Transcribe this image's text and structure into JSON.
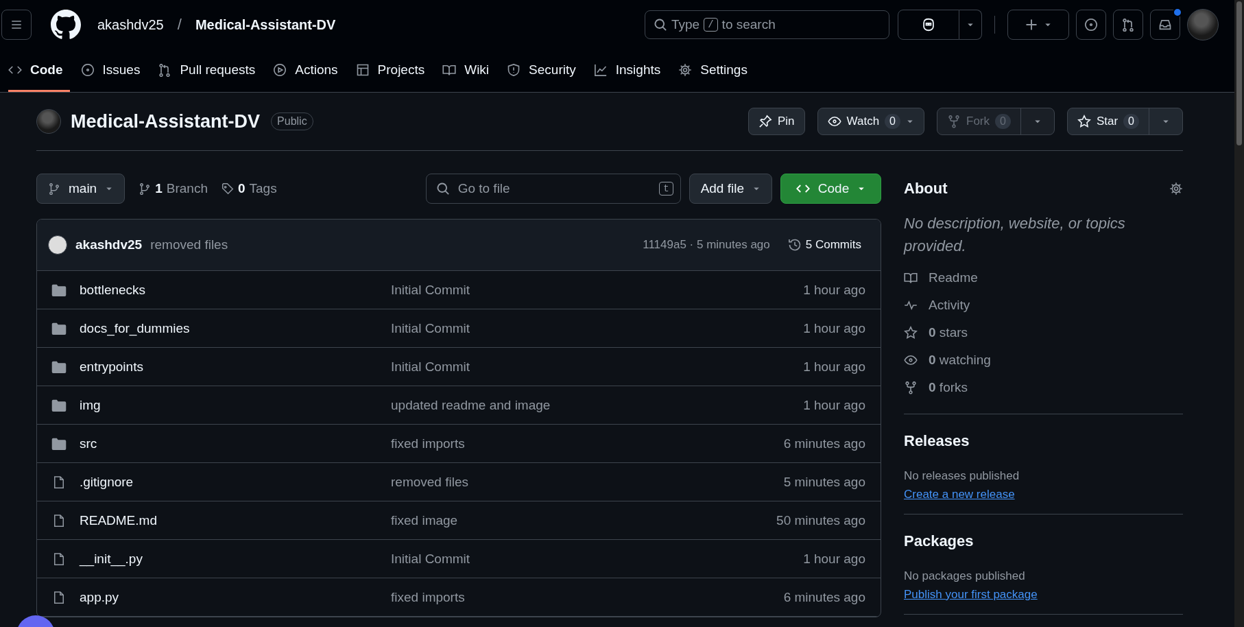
{
  "header": {
    "owner": "akashdv25",
    "separator": "/",
    "repo": "Medical-Assistant-DV",
    "search": {
      "placeholder_before": "Type",
      "key": "/",
      "placeholder_after": "to search"
    },
    "inbox_unread": true
  },
  "nav_tabs": [
    {
      "kind": "code",
      "label": "Code",
      "selected": true
    },
    {
      "kind": "issues",
      "label": "Issues",
      "selected": false
    },
    {
      "kind": "pulls",
      "label": "Pull requests",
      "selected": false
    },
    {
      "kind": "actions",
      "label": "Actions",
      "selected": false
    },
    {
      "kind": "projects",
      "label": "Projects",
      "selected": false
    },
    {
      "kind": "wiki",
      "label": "Wiki",
      "selected": false
    },
    {
      "kind": "security",
      "label": "Security",
      "selected": false
    },
    {
      "kind": "insights",
      "label": "Insights",
      "selected": false
    },
    {
      "kind": "settings",
      "label": "Settings",
      "selected": false
    }
  ],
  "repo": {
    "name": "Medical-Assistant-DV",
    "visibility": "Public",
    "actions": [
      {
        "kind": "pin",
        "label": "Pin",
        "disabled": false
      },
      {
        "kind": "watch",
        "label": "Watch",
        "count": "0",
        "disabled": false
      },
      {
        "kind": "fork",
        "label": "Fork",
        "count": "0",
        "disabled": true
      },
      {
        "kind": "star",
        "label": "Star",
        "count": "0",
        "disabled": false
      }
    ]
  },
  "toolbar": {
    "branch": "main",
    "branch_count": "1",
    "branch_label": "Branch",
    "tag_count": "0",
    "tag_label": "Tags",
    "go_to_file": {
      "placeholder": "Go to file",
      "shortcut": "t"
    },
    "add_file": "Add file",
    "code_button": "Code"
  },
  "latest_commit": {
    "author": "akashdv25",
    "message": "removed files",
    "meta": "11149a5 · 5 minutes ago",
    "commits": "5 Commits"
  },
  "files": [
    {
      "kind": "folder",
      "name": "bottlenecks",
      "message": "Initial Commit",
      "time": "1 hour ago"
    },
    {
      "kind": "folder",
      "name": "docs_for_dummies",
      "message": "Initial Commit",
      "time": "1 hour ago"
    },
    {
      "kind": "folder",
      "name": "entrypoints",
      "message": "Initial Commit",
      "time": "1 hour ago"
    },
    {
      "kind": "folder",
      "name": "img",
      "message": "updated readme and image",
      "time": "1 hour ago"
    },
    {
      "kind": "folder",
      "name": "src",
      "message": "fixed imports",
      "time": "6 minutes ago"
    },
    {
      "kind": "file",
      "name": ".gitignore",
      "message": "removed files",
      "time": "5 minutes ago"
    },
    {
      "kind": "file",
      "name": "README.md",
      "message": "fixed image",
      "time": "50 minutes ago"
    },
    {
      "kind": "file",
      "name": "__init__.py",
      "message": "Initial Commit",
      "time": "1 hour ago"
    },
    {
      "kind": "file",
      "name": "app.py",
      "message": "fixed imports",
      "time": "6 minutes ago"
    }
  ],
  "about": {
    "title": "About",
    "description": "No description, website, or topics provided.",
    "links": [
      {
        "kind": "readme",
        "text": "Readme"
      },
      {
        "kind": "activity",
        "text": "Activity"
      },
      {
        "kind": "stars",
        "text": "**0** stars"
      },
      {
        "kind": "watching",
        "text": "**0** watching"
      },
      {
        "kind": "forks",
        "text": "**0** forks"
      }
    ]
  },
  "sections": [
    {
      "title": "Releases",
      "note": "No releases published",
      "link": "Create a new release"
    },
    {
      "title": "Packages",
      "note": "No packages published",
      "link": "Publish your first package"
    }
  ]
}
